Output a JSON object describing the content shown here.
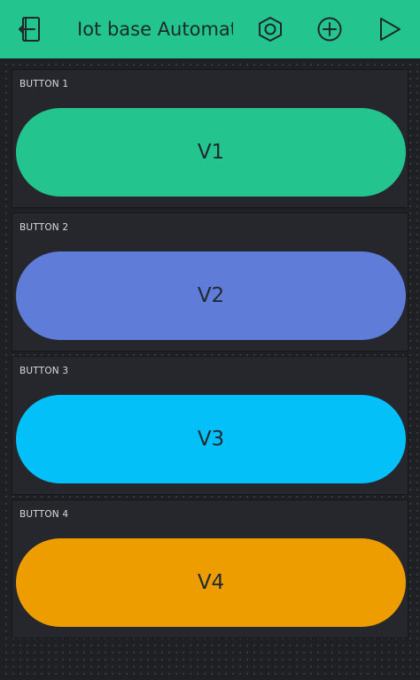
{
  "header": {
    "title": "Iot base Automatic",
    "icons": {
      "back": "exit-project-icon",
      "settings": "hexagon-settings-icon",
      "add": "add-widget-icon",
      "play": "play-icon"
    },
    "color": "#23c48e"
  },
  "widgets": [
    {
      "label": "BUTTON 1",
      "value": "V1",
      "color": "#23c48e"
    },
    {
      "label": "BUTTON 2",
      "value": "V2",
      "color": "#5f7cd8"
    },
    {
      "label": "BUTTON 3",
      "value": "V3",
      "color": "#04c0f8"
    },
    {
      "label": "BUTTON 4",
      "value": "V4",
      "color": "#ed9d00"
    }
  ]
}
